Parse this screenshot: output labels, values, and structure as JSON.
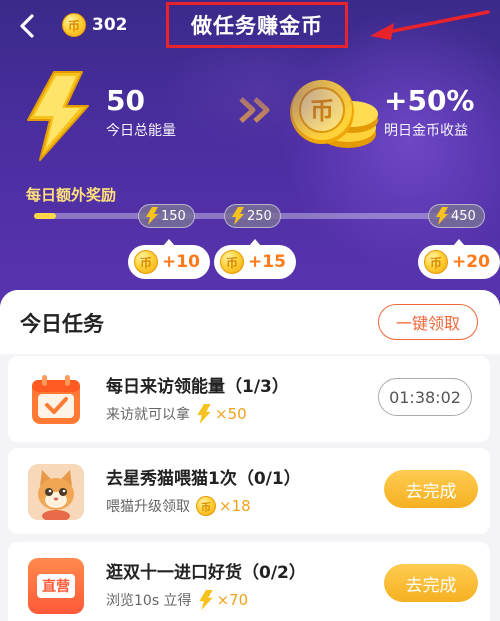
{
  "header": {
    "coins": "302",
    "title": "做任务赚金币"
  },
  "stats": {
    "energy_value": "50",
    "energy_label": "今日总能量",
    "bonus_value": "+50%",
    "bonus_label": "明日金币收益"
  },
  "extra_reward": {
    "label": "每日额外奖励",
    "progress": 0.05,
    "milestones": [
      {
        "energy": "150",
        "reward": "+10"
      },
      {
        "energy": "250",
        "reward": "+15"
      },
      {
        "energy": "450",
        "reward": "+20"
      }
    ]
  },
  "tasks_section": {
    "title": "今日任务",
    "claim_all_label": "一键领取",
    "tasks": [
      {
        "title": "每日来访领能量（1/3）",
        "subtitle": "来访就可以拿",
        "reward_type": "energy",
        "reward": "×50",
        "action": "01:38:02"
      },
      {
        "title": "去星秀猫喂猫1次（0/1）",
        "subtitle": "喂猫升级领取",
        "reward_type": "coin",
        "reward": "×18",
        "action": "去完成"
      },
      {
        "title": "逛双十一进口好货（0/2）",
        "subtitle": "浏览10s 立得",
        "reward_type": "energy",
        "reward": "×70",
        "action": "去完成",
        "icon_text": "直营"
      }
    ]
  },
  "colors": {
    "accent": "#f5b021",
    "title_box_border": "#e8232c",
    "claim_border": "#f1683a"
  }
}
